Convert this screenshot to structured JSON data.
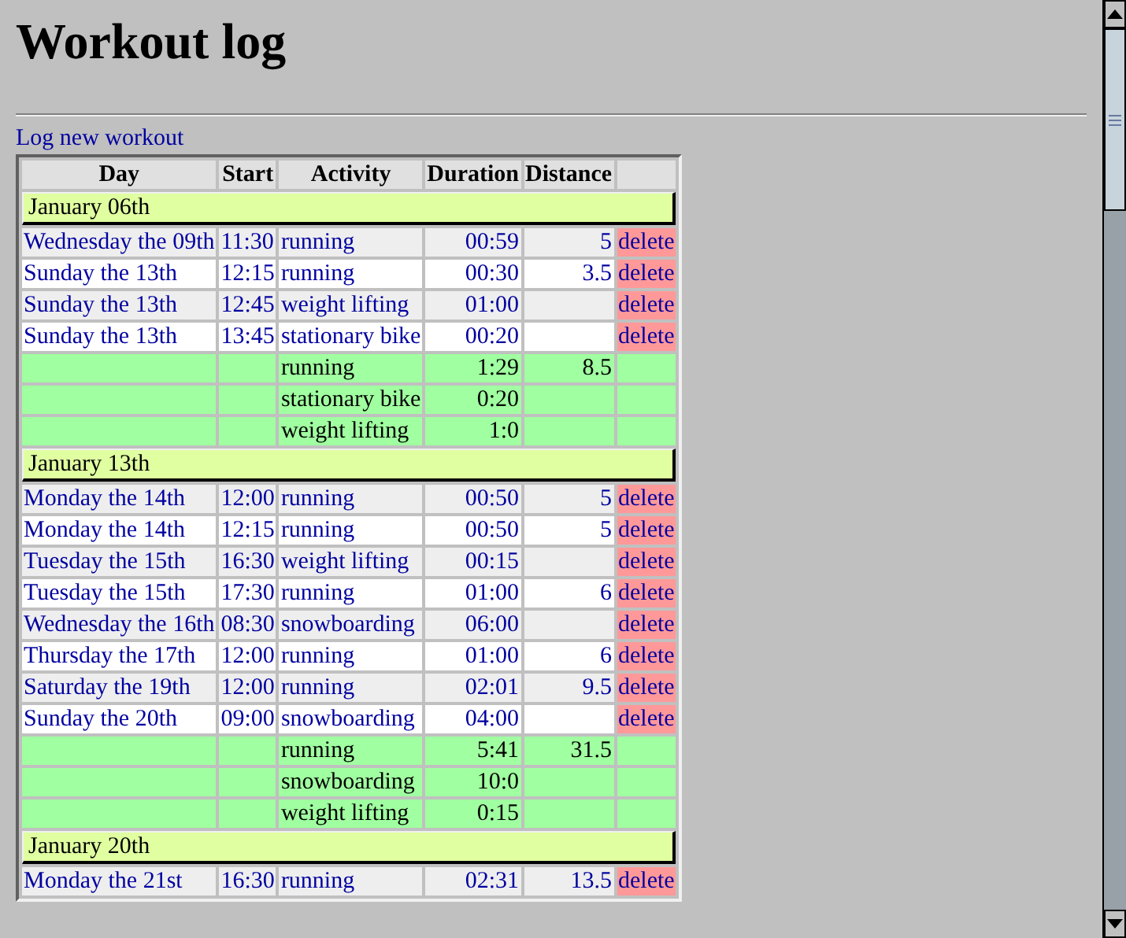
{
  "title": "Workout log",
  "new_link": "Log new workout",
  "table": {
    "columns": [
      "Day",
      "Start",
      "Activity",
      "Duration",
      "Distance"
    ],
    "groups": [
      {
        "label": "January 06th",
        "entries": [
          {
            "day": "Wednesday the 09th",
            "start": "11:30",
            "activity": "running",
            "duration": "00:59",
            "distance": "5",
            "action": "delete"
          },
          {
            "day": "Sunday the 13th",
            "start": "12:15",
            "activity": "running",
            "duration": "00:30",
            "distance": "3.5",
            "action": "delete"
          },
          {
            "day": "Sunday the 13th",
            "start": "12:45",
            "activity": "weight lifting",
            "duration": "01:00",
            "action": "delete"
          },
          {
            "day": "Sunday the 13th",
            "start": "13:45",
            "activity": "stationary bike",
            "duration": "00:20",
            "action": "delete"
          }
        ],
        "totals": [
          {
            "activity": "running",
            "duration": "1:29",
            "distance": "8.5"
          },
          {
            "activity": "stationary bike",
            "duration": "0:20"
          },
          {
            "activity": "weight lifting",
            "duration": "1:0"
          }
        ]
      },
      {
        "label": "January 13th",
        "entries": [
          {
            "day": "Monday the 14th",
            "start": "12:00",
            "activity": "running",
            "duration": "00:50",
            "distance": "5",
            "action": "delete"
          },
          {
            "day": "Monday the 14th",
            "start": "12:15",
            "activity": "running",
            "duration": "00:50",
            "distance": "5",
            "action": "delete"
          },
          {
            "day": "Tuesday the 15th",
            "start": "16:30",
            "activity": "weight lifting",
            "duration": "00:15",
            "action": "delete"
          },
          {
            "day": "Tuesday the 15th",
            "start": "17:30",
            "activity": "running",
            "duration": "01:00",
            "distance": "6",
            "action": "delete"
          },
          {
            "day": "Wednesday the 16th",
            "start": "08:30",
            "activity": "snowboarding",
            "duration": "06:00",
            "action": "delete"
          },
          {
            "day": "Thursday the 17th",
            "start": "12:00",
            "activity": "running",
            "duration": "01:00",
            "distance": "6",
            "action": "delete"
          },
          {
            "day": "Saturday the 19th",
            "start": "12:00",
            "activity": "running",
            "duration": "02:01",
            "distance": "9.5",
            "action": "delete"
          },
          {
            "day": "Sunday the 20th",
            "start": "09:00",
            "activity": "snowboarding",
            "duration": "04:00",
            "action": "delete"
          }
        ],
        "totals": [
          {
            "activity": "running",
            "duration": "5:41",
            "distance": "31.5"
          },
          {
            "activity": "snowboarding",
            "duration": "10:0"
          },
          {
            "activity": "weight lifting",
            "duration": "0:15"
          }
        ]
      },
      {
        "label": "January 20th",
        "entries": [
          {
            "day": "Monday the 21st",
            "start": "16:30",
            "activity": "running",
            "duration": "02:31",
            "distance": "13.5",
            "action": "delete"
          }
        ]
      }
    ]
  }
}
